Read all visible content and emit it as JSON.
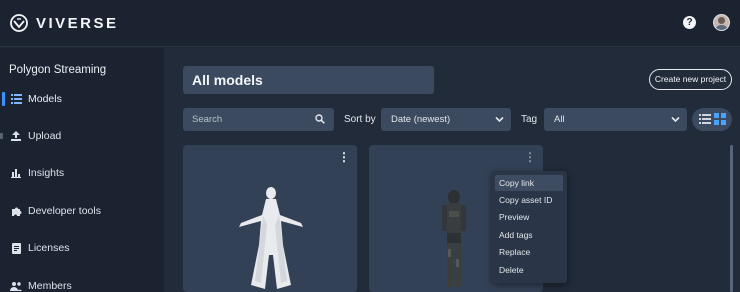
{
  "app": {
    "brand": "VIVERSE"
  },
  "topbar": {
    "help_icon": "question-circle-icon",
    "help_glyph": "?",
    "avatar_icon": "user-avatar"
  },
  "sidebar": {
    "project_title": "Polygon Streaming",
    "items": [
      {
        "label": "Models",
        "icon": "list-icon",
        "active": true
      },
      {
        "label": "Upload",
        "icon": "upload-icon"
      },
      {
        "label": "Insights",
        "icon": "bar-chart-icon"
      },
      {
        "label": "Developer tools",
        "icon": "puzzle-icon"
      },
      {
        "label": "Licenses",
        "icon": "document-icon"
      },
      {
        "label": "Members",
        "icon": "people-icon"
      }
    ]
  },
  "main": {
    "title": "All models",
    "create_button": "Create new project",
    "search": {
      "placeholder": "Search"
    },
    "sort": {
      "label": "Sort by",
      "value": "Date (newest)"
    },
    "tag": {
      "label": "Tag",
      "value": "All"
    },
    "view_mode": "grid"
  },
  "context_menu": {
    "items": [
      "Copy link",
      "Copy asset ID",
      "Preview",
      "Add tags",
      "Replace",
      "Delete"
    ],
    "highlighted": "Copy link"
  },
  "colors": {
    "accent": "#3b93ff",
    "background": "#1e2736",
    "card": "#334157",
    "field": "#3b4a5e"
  }
}
